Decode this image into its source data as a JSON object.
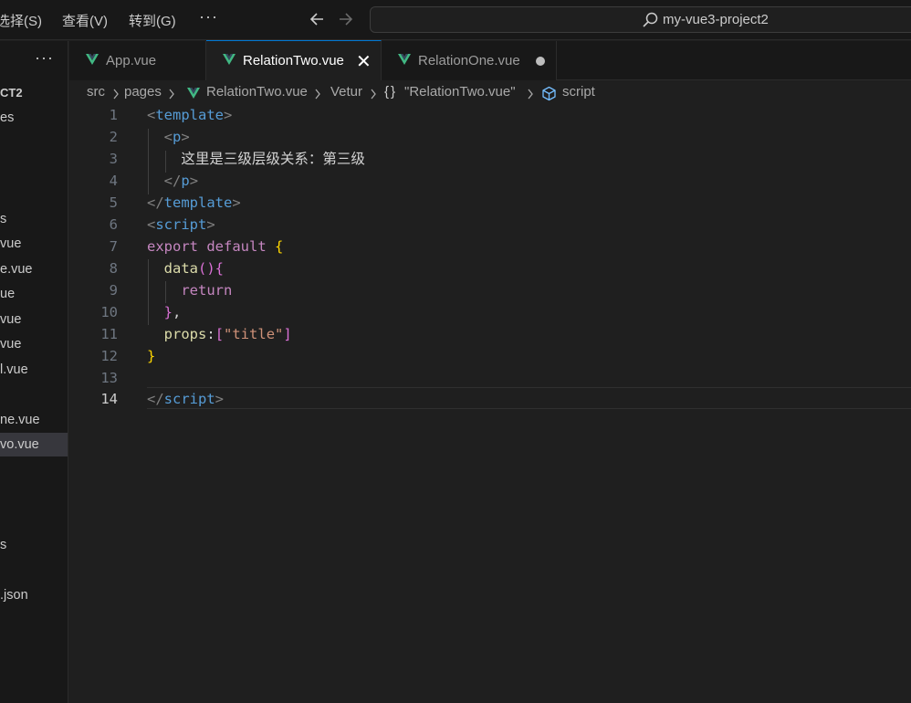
{
  "titlebar": {
    "menu": [
      "选择(S)",
      "查看(V)",
      "转到(G)"
    ],
    "more": "···",
    "search_text": "my-vue3-project2"
  },
  "sidebar": {
    "more": "···",
    "items": [
      {
        "label": "CT2"
      },
      {
        "label": "es"
      },
      {
        "label": "s"
      },
      {
        "label": "vue"
      },
      {
        "label": "e.vue"
      },
      {
        "label": "ue"
      },
      {
        "label": "vue"
      },
      {
        "label": "vue"
      },
      {
        "label": "l.vue"
      },
      {
        "label": "ne.vue"
      },
      {
        "label": "vo.vue"
      },
      {
        "label": "s"
      },
      {
        "label": ".json"
      }
    ]
  },
  "tabs": [
    {
      "label": "App.vue",
      "active": false
    },
    {
      "label": "RelationTwo.vue",
      "active": true,
      "close": "✕"
    },
    {
      "label": "RelationOne.vue",
      "active": false,
      "modified": true
    }
  ],
  "breadcrumb": {
    "parts": [
      "src",
      "pages",
      "RelationTwo.vue",
      "Vetur",
      "\"RelationTwo.vue\"",
      "script"
    ],
    "braces": "{}"
  },
  "editor": {
    "active_line": 14,
    "line_numbers": [
      "1",
      "2",
      "3",
      "4",
      "5",
      "6",
      "7",
      "8",
      "9",
      "10",
      "11",
      "12",
      "13",
      "14"
    ],
    "tokens": {
      "l1_open": "<",
      "l1_tag": "template",
      "l1_close": ">",
      "l2_open": "<",
      "l2_tag": "p",
      "l2_close": ">",
      "l3_text": "这里是三级层级关系：第三级",
      "l4_open": "</",
      "l4_tag": "p",
      "l4_close": ">",
      "l5_open": "</",
      "l5_tag": "template",
      "l5_close": ">",
      "l6_open": "<",
      "l6_tag": "script",
      "l6_close": ">",
      "l7_kw": "export default",
      "l7_brace": "{",
      "l8_fn": "data",
      "l8_paren": "()",
      "l8_brace": "{",
      "l9_kw": "return",
      "l10_brace": "}",
      "l10_comma": ",",
      "l11_prop": "props",
      "l11_colon": ":",
      "l11_lb": "[",
      "l11_str": "\"title\"",
      "l11_rb": "]",
      "l12_brace": "}",
      "l14_open": "</",
      "l14_tag": "script",
      "l14_close": ">"
    }
  },
  "colors": {
    "accent": "#0078d4",
    "vue_green": "#41b883",
    "tag": "#569cd6",
    "keyword": "#c586c0",
    "string": "#ce9178",
    "function": "#dcdcaa",
    "brace": "#ffd700"
  }
}
